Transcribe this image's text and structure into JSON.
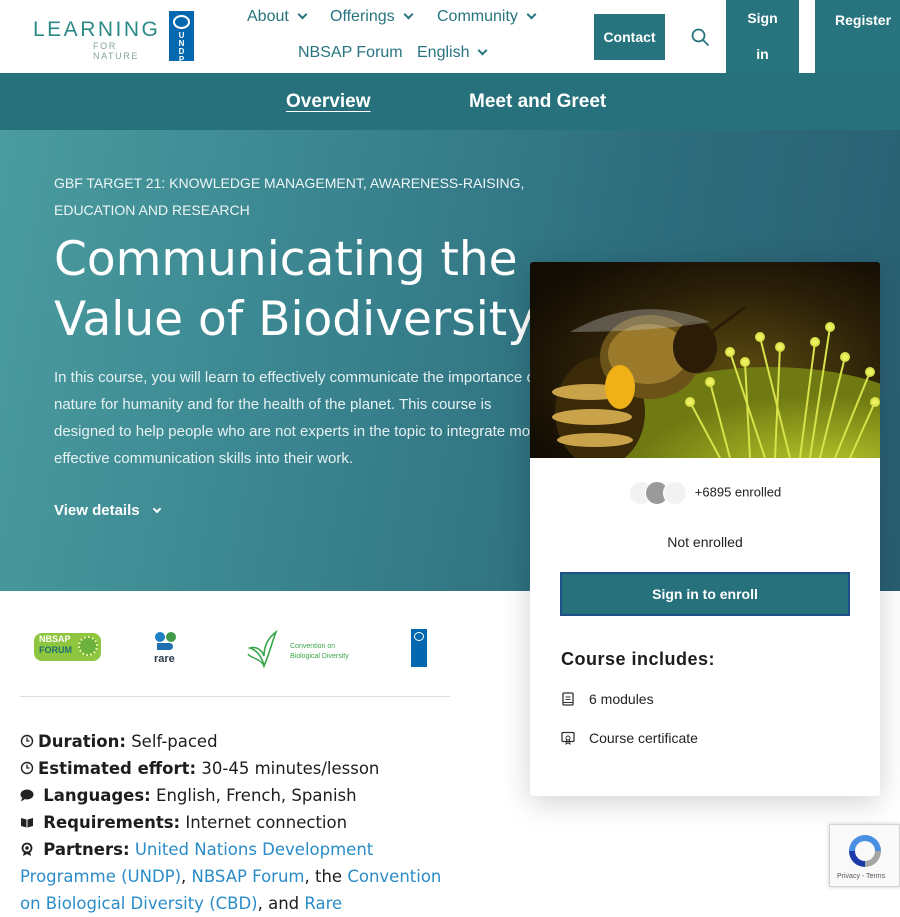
{
  "header": {
    "logo_text": "LEARNING",
    "logo_sub": "FOR NATURE",
    "undp_letters": [
      "U",
      "N",
      "D",
      "P"
    ],
    "nav": [
      {
        "label": "About",
        "has_dropdown": true
      },
      {
        "label": "Offerings",
        "has_dropdown": true
      },
      {
        "label": "Community",
        "has_dropdown": true
      },
      {
        "label": "NBSAP Forum",
        "has_dropdown": false
      },
      {
        "label": "English",
        "has_dropdown": true
      }
    ],
    "contact_label": "Contact",
    "signin_label_1": "Sign",
    "signin_label_2": "in",
    "register_label": "Register"
  },
  "tabs": [
    {
      "label": "Overview",
      "active": true
    },
    {
      "label": "Meet and Greet",
      "active": false
    }
  ],
  "hero": {
    "target": "GBF TARGET 21: KNOWLEDGE MANAGEMENT, AWARENESS-RAISING, EDUCATION AND RESEARCH",
    "title": "Communicating the Value of Biodiversity",
    "description": "In this course, you will learn to effectively communicate the importance of nature for humanity and for the health of the planet. This course is designed to help people who are not experts in the topic to integrate more effective communication skills into their work.",
    "view_details": "View details"
  },
  "card": {
    "enrolled": "+6895 enrolled",
    "status": "Not enrolled",
    "enroll_button": "Sign in to enroll",
    "includes_title": "Course includes:",
    "includes": [
      {
        "icon": "book-icon",
        "label": "6 modules"
      },
      {
        "icon": "certificate-icon",
        "label": "Course certificate"
      }
    ]
  },
  "partners": {
    "nbsap_1": "NBSAP",
    "nbsap_2": "FORUM",
    "rare": "rare",
    "cbd_1": "Convention on",
    "cbd_2": "Biological Diversity"
  },
  "details": {
    "duration_label": "Duration:",
    "duration_value": "Self-paced",
    "effort_label": "Estimated effort:",
    "effort_value": "30-45 minutes/lesson",
    "languages_label": "Languages:",
    "languages_value": "English, French, Spanish",
    "requirements_label": "Requirements:",
    "requirements_value": "Internet connection",
    "partners_label": "Partners:",
    "partner_undp": "United Nations Development Programme (UNDP)",
    "sep1": ",",
    "partner_nbsap": "NBSAP Forum",
    "sep2": ", the",
    "partner_cbd": "Convention on Biological Diversity (CBD)",
    "sep3": ", and",
    "partner_rare": "Rare"
  },
  "recaptcha": {
    "text": "Privacy - Terms"
  },
  "colors": {
    "primary": "#27747f",
    "link": "#2a8cc8"
  }
}
